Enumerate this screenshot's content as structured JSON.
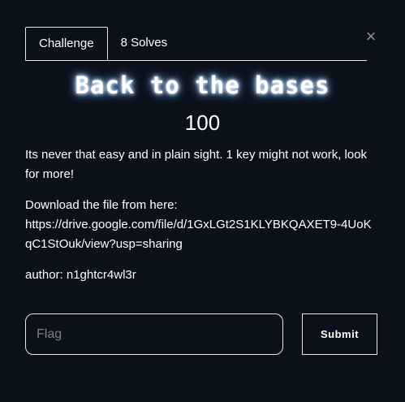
{
  "modal": {
    "close_icon": "close-icon",
    "tabs": [
      {
        "label": "Challenge",
        "active": true
      },
      {
        "label": "8 Solves",
        "active": false
      }
    ],
    "challenge": {
      "name": "Back to the bases",
      "value": "100",
      "description": {
        "line1": "Its never that easy and in plain sight. 1 key might not work, look for more!",
        "download_label": "Download the file from here:",
        "download_url": "https://drive.google.com/file/d/1GxLGt2S1KLYBKQAXET9-4UoKqC1StOuk/view?usp=sharing",
        "author": "author: n1ghtcr4wl3r"
      }
    },
    "flag_input": {
      "placeholder": "Flag",
      "value": ""
    },
    "submit_label": "Submit"
  },
  "colors": {
    "background": "#0b111a",
    "text": "#ffffff",
    "border": "#e6e6e6",
    "placeholder": "#7b8087",
    "title_glow": "#6aa7ff"
  }
}
